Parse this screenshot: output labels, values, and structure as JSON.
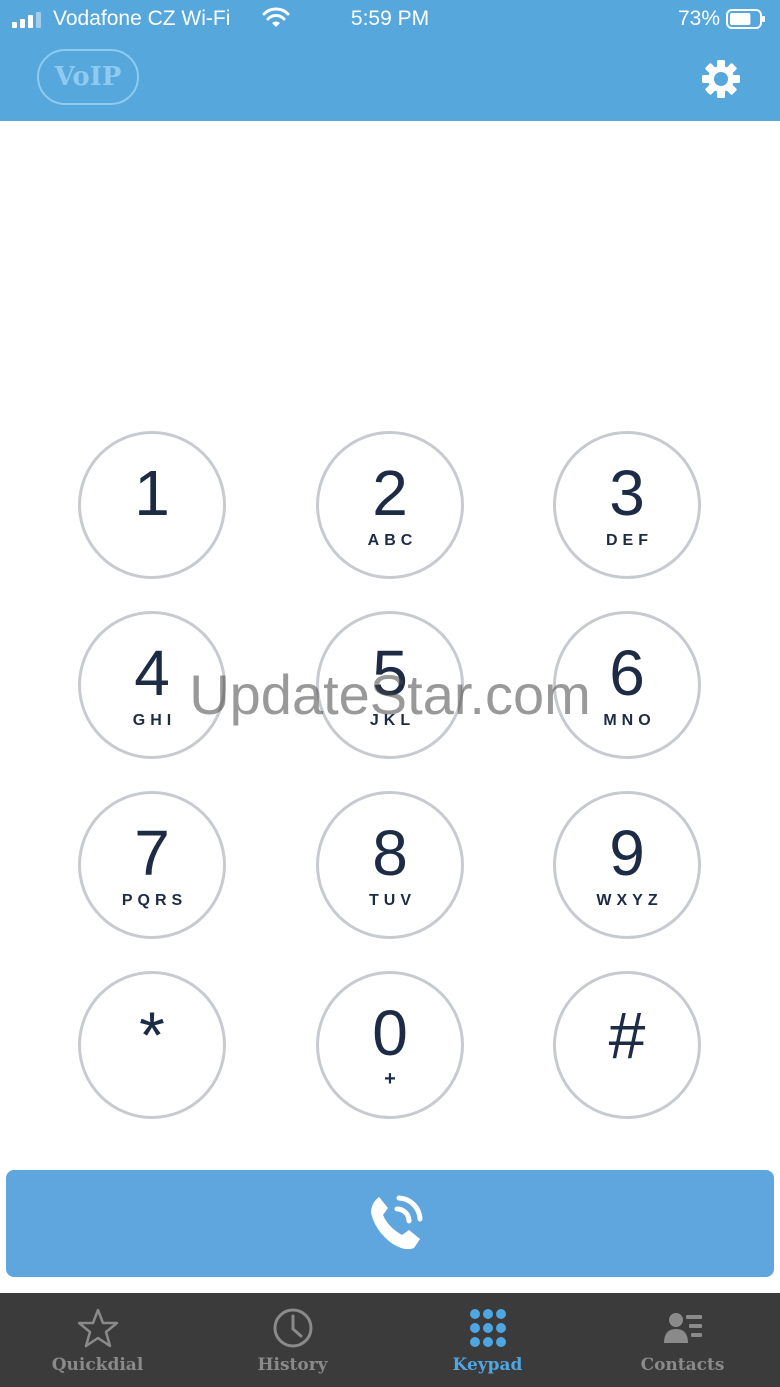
{
  "status_bar": {
    "carrier": "Vodafone CZ Wi-Fi",
    "time": "5:59 PM",
    "battery_percent": "73%",
    "battery_level": 0.73
  },
  "app_bar": {
    "logo_text": "VoIP",
    "settings_icon": "gear-icon"
  },
  "dialer": {
    "number": ""
  },
  "keypad": {
    "keys": [
      {
        "digit": "1",
        "letters": ""
      },
      {
        "digit": "2",
        "letters": "ABC"
      },
      {
        "digit": "3",
        "letters": "DEF"
      },
      {
        "digit": "4",
        "letters": "GHI"
      },
      {
        "digit": "5",
        "letters": "JKL"
      },
      {
        "digit": "6",
        "letters": "MNO"
      },
      {
        "digit": "7",
        "letters": "PQRS"
      },
      {
        "digit": "8",
        "letters": "TUV"
      },
      {
        "digit": "9",
        "letters": "WXYZ"
      },
      {
        "digit": "*",
        "letters": ""
      },
      {
        "digit": "0",
        "letters": "+"
      },
      {
        "digit": "#",
        "letters": ""
      }
    ]
  },
  "call_button": {
    "icon": "phone-call-icon"
  },
  "watermark": {
    "text": "UpdateStar.com"
  },
  "tab_bar": {
    "tabs": [
      {
        "label": "Quickdial",
        "icon": "star-icon",
        "active": false
      },
      {
        "label": "History",
        "icon": "clock-icon",
        "active": false
      },
      {
        "label": "Keypad",
        "icon": "keypad-icon",
        "active": true
      },
      {
        "label": "Contacts",
        "icon": "contacts-icon",
        "active": false
      }
    ]
  },
  "colors": {
    "header_blue": "#56a7dc",
    "call_button_blue": "#5fa6df",
    "key_border": "#c7cbcf",
    "key_text": "#1d2b45",
    "tabbar_bg": "#3b3b3b",
    "tab_inactive": "#8a8a8a",
    "tab_active": "#4ea6e2"
  }
}
